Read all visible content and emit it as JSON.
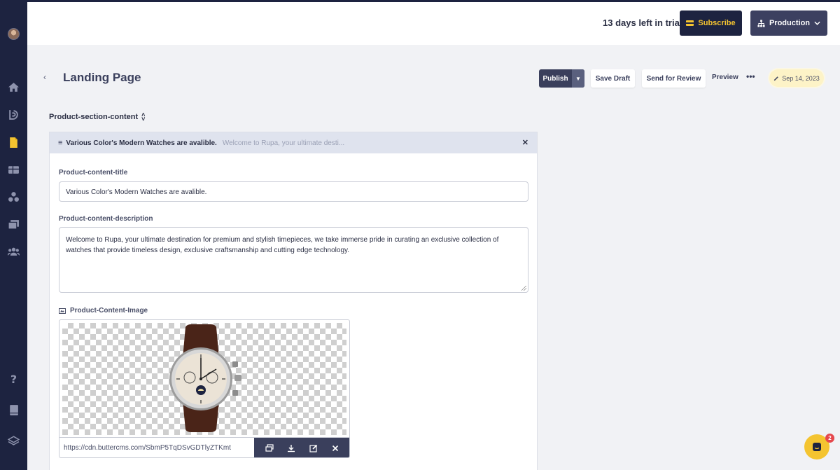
{
  "header": {
    "trial_text": "13 days left in trial",
    "subscribe_label": "Subscribe",
    "environment_label": "Production"
  },
  "page": {
    "title": "Landing Page",
    "publish_label": "Publish",
    "save_draft_label": "Save Draft",
    "send_review_label": "Send for Review",
    "preview_label": "Preview",
    "more_label": "•••",
    "date_badge": "Sep 14, 2023"
  },
  "section": {
    "label": "Product-section-content",
    "card_title": "Various Color's Modern Watches are avalible.",
    "card_preview": "Welcome to Rupa, your ultimate desti...",
    "title_label": "Product-content-title",
    "title_value": "Various Color's Modern Watches are avalible.",
    "description_label": "Product-content-description",
    "description_value": "Welcome to Rupa, your ultimate destination for premium and stylish timepieces, we take immerse pride in curating an exclusive collection of watches that provide timeless design, exclusive craftsmanship and cutting edge technology.",
    "image_label": "Product-Content-Image",
    "image_url": "https://cdn.buttercms.com/SbmP5TqDSvGDTlyZTKmt"
  },
  "chat": {
    "badge_count": "2"
  },
  "colors": {
    "sidebar": "#1d2340",
    "accent_yellow": "#f4c430",
    "primary_button": "#3a3f5c"
  },
  "icons": {
    "sidebar": [
      "home-icon",
      "blog-icon",
      "pages-icon",
      "collections-icon",
      "components-icon",
      "media-icon",
      "users-icon",
      "help-icon",
      "docs-icon",
      "layers-icon"
    ]
  }
}
